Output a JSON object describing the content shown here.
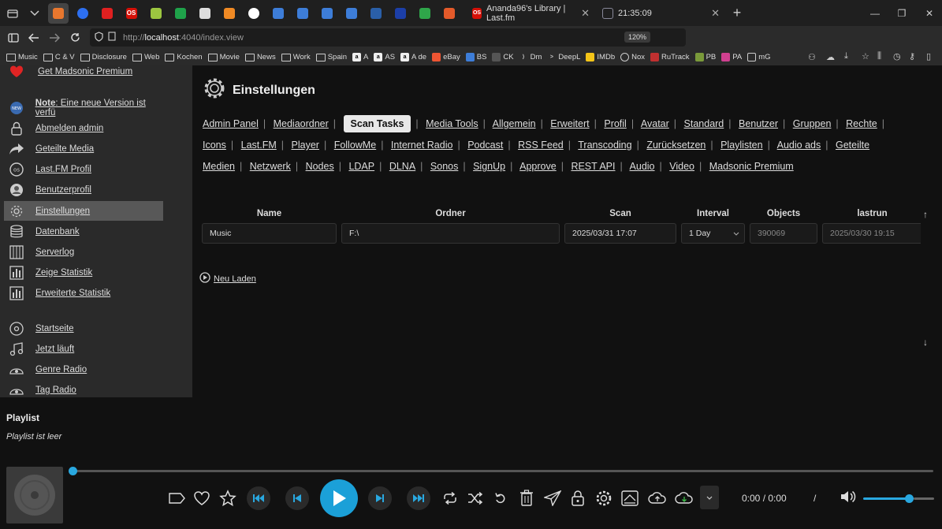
{
  "browser": {
    "tabs": [
      {
        "label": "Ananda96's Library | Last.fm",
        "fav": "OS",
        "color": "#d51007"
      },
      {
        "label": "21:35:09",
        "fav": "",
        "color": "#3a4a6a"
      }
    ],
    "url_prefix": "http://",
    "url_host": "localhost",
    "url_path": ":4040/index.view",
    "zoom": "120%",
    "ext_badge": "120"
  },
  "bookmarks": [
    "Music",
    "C & V",
    "Disclosure",
    "Web",
    "Kochen",
    "Movie",
    "News",
    "Work",
    "Spain",
    "A",
    "AS",
    "A de",
    "eBay",
    "BS",
    "CK",
    "Dm",
    "DeepL",
    "IMDb",
    "Nox",
    "RuTrack",
    "PB",
    "PA",
    "mG"
  ],
  "sidebar": {
    "premium": "Get Madsonic Premium",
    "items": [
      {
        "label": "Note: Eine neue Version ist verfü",
        "icon": "new-badge-icon"
      },
      {
        "label": "Abmelden admin",
        "icon": "lock-icon"
      },
      {
        "label": "Geteilte Media",
        "icon": "share-arrow-icon"
      },
      {
        "label": "Last.FM Profil",
        "icon": "lastfm-icon"
      },
      {
        "label": "Benutzerprofil",
        "icon": "user-icon"
      },
      {
        "label": "Einstellungen",
        "icon": "gear-icon"
      },
      {
        "label": "Datenbank",
        "icon": "database-icon"
      },
      {
        "label": "Serverlog",
        "icon": "log-icon"
      },
      {
        "label": "Zeige Statistik",
        "icon": "stats-icon"
      },
      {
        "label": "Erweiterte Statistik",
        "icon": "stats-icon"
      },
      {
        "label": "Startseite",
        "icon": "home-disc-icon"
      },
      {
        "label": "Jetzt läuft",
        "icon": "music-note-icon"
      },
      {
        "label": "Genre Radio",
        "icon": "radio-icon"
      },
      {
        "label": "Tag Radio",
        "icon": "radio-icon"
      }
    ]
  },
  "main": {
    "title": "Einstellungen",
    "menu_row1": [
      "Admin Panel",
      "Mediaordner",
      "Scan Tasks",
      "Media Tools",
      "Allgemein",
      "Erweitert",
      "Profil",
      "Avatar",
      "Standard",
      "Benutzer",
      "Gruppen",
      "Rechte"
    ],
    "menu_row2": [
      "Icons",
      "Last.FM",
      "Player",
      "FollowMe",
      "Internet Radio",
      "Podcast",
      "RSS Feed",
      "Transcoding",
      "Zurücksetzen",
      "Playlisten",
      "Audio ads",
      "Geteilte"
    ],
    "menu_row3": [
      "Medien",
      "Netzwerk",
      "Nodes",
      "LDAP",
      "DLNA",
      "Sonos",
      "SignUp",
      "Approve",
      "REST API",
      "Audio",
      "Video",
      "Madsonic Premium"
    ],
    "current": "Scan Tasks",
    "table": {
      "headers": {
        "name": "Name",
        "ordner": "Ordner",
        "scan": "Scan",
        "interval": "Interval",
        "objects": "Objects",
        "lastrun": "lastrun"
      },
      "row": {
        "name": "Music",
        "ordner": "F:\\",
        "scan": "2025/03/31 17:07",
        "interval": "1 Day",
        "objects": "390069",
        "lastrun": "2025/03/30 19:15"
      }
    },
    "reload": "Neu Laden"
  },
  "playlist": {
    "title": "Playlist",
    "empty": "Playlist ist leer"
  },
  "player": {
    "time": "0:00 / 0:00",
    "slash": "/",
    "progress": 0,
    "volume": 0.72
  }
}
